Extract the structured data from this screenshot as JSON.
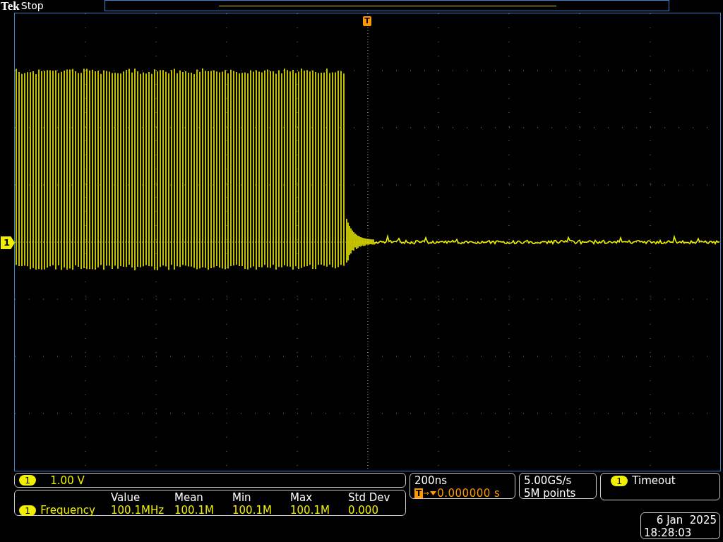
{
  "header": {
    "brand": "Tek",
    "status": "Stop"
  },
  "trigger_marker": {
    "label": "T"
  },
  "channel_marker": {
    "label": "1"
  },
  "vertical": {
    "channel": "1",
    "scale": "1.00 V"
  },
  "measurement": {
    "columns": [
      "Value",
      "Mean",
      "Min",
      "Max",
      "Std Dev"
    ],
    "rows": [
      {
        "channel": "1",
        "name": "Frequency",
        "values": [
          "100.1MHz",
          "100.1M",
          "100.1M",
          "100.1M",
          "0.000"
        ]
      }
    ]
  },
  "horizontal": {
    "scale": "200ns",
    "trigger_icon": "T",
    "position": "0.000000 s"
  },
  "acquisition": {
    "rate": "5.00GS/s",
    "length": "5M points"
  },
  "trigger": {
    "channel": "1",
    "mode": "Timeout"
  },
  "datetime": {
    "date": "6 Jan  2025",
    "time": "18:28:03"
  }
}
